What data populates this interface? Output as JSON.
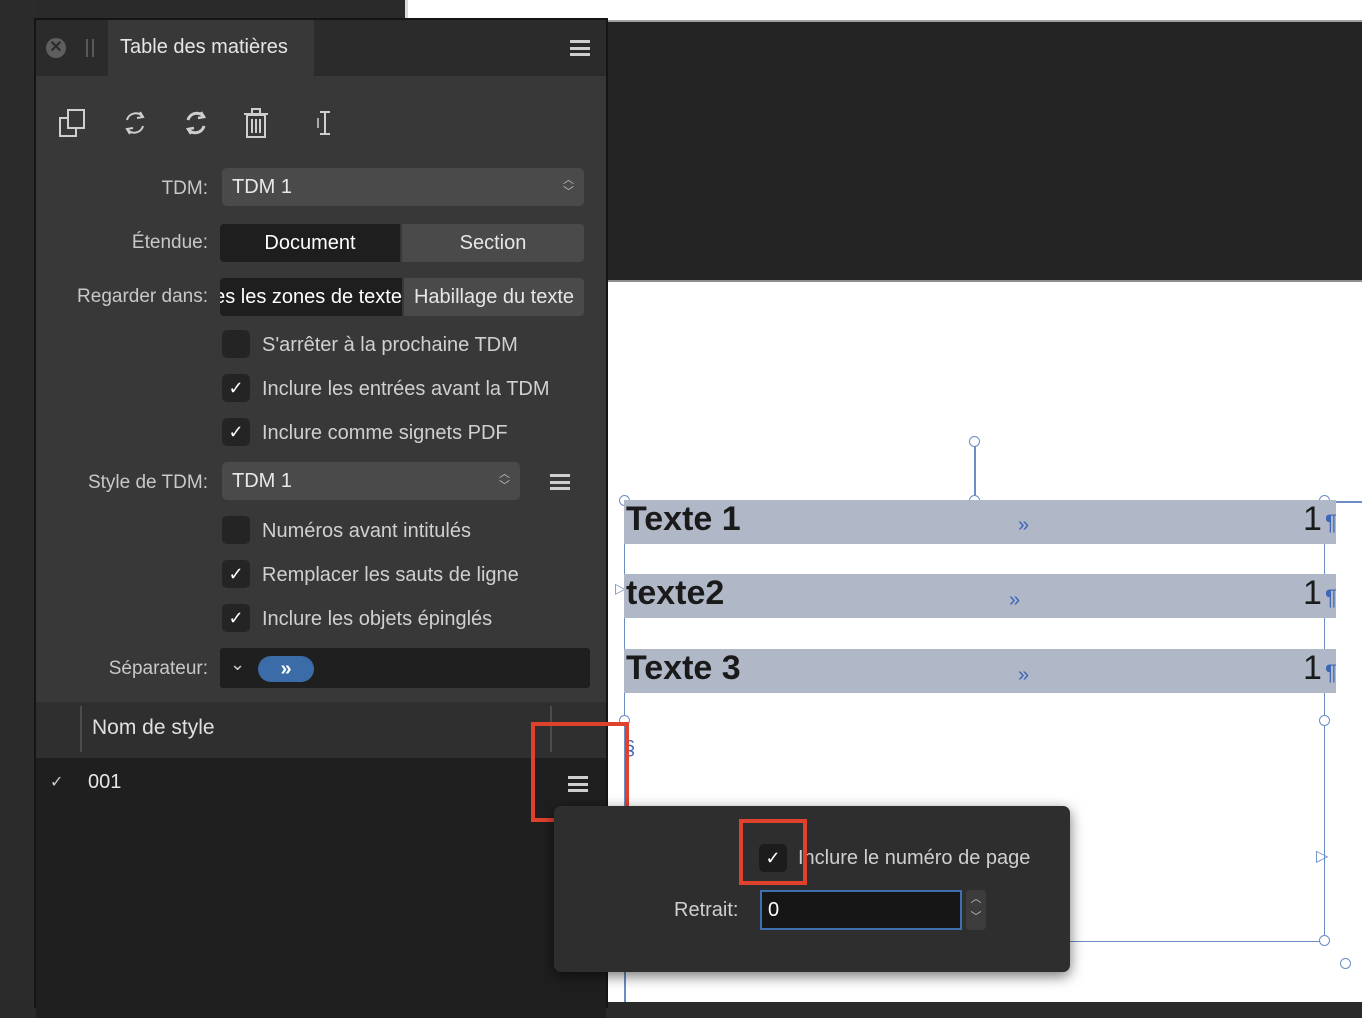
{
  "panel": {
    "title": "Table des matières",
    "close_glyph": "✕",
    "toolbar": {
      "icons": [
        "duplicate-icon",
        "refresh-icon",
        "update-icon",
        "trash-icon",
        "text-cursor-icon"
      ]
    },
    "tdm": {
      "label": "TDM:",
      "value": "TDM 1"
    },
    "etendue": {
      "label": "Étendue:",
      "options": [
        "Document",
        "Section"
      ],
      "selected": "Document"
    },
    "regarder": {
      "label": "Regarder dans:",
      "options": [
        "ıtes les zones de texte",
        "Habillage du texte"
      ],
      "selected": "ıtes les zones de texte"
    },
    "checks_a": [
      {
        "label": "S'arrêter à la prochaine TDM",
        "checked": false
      },
      {
        "label": "Inclure les entrées avant la TDM",
        "checked": true
      },
      {
        "label": "Inclure comme signets PDF",
        "checked": true
      }
    ],
    "style_tdm": {
      "label": "Style de TDM:",
      "value": "TDM 1"
    },
    "checks_b": [
      {
        "label": "Numéros avant intitulés",
        "checked": false
      },
      {
        "label": "Remplacer les sauts de ligne",
        "checked": true
      },
      {
        "label": "Inclure les objets épinglés",
        "checked": true
      }
    ],
    "separateur": {
      "label": "Séparateur:",
      "token": "»"
    },
    "list": {
      "header": "Nom de style",
      "rows": [
        {
          "name": "001",
          "checked": true
        }
      ]
    }
  },
  "document": {
    "entries": [
      {
        "text": "Texte 1",
        "sep": "»",
        "page": "1",
        "pilcrow": "¶"
      },
      {
        "text": "texte2",
        "sep": "»",
        "page": "1",
        "pilcrow": "¶"
      },
      {
        "text": "Texte 3",
        "sep": "»",
        "page": "1",
        "pilcrow": "¶"
      }
    ],
    "section_mark": "§"
  },
  "popover": {
    "include_page_number": {
      "label": "Inclure le numéro de page",
      "checked": true
    },
    "retrait": {
      "label": "Retrait:",
      "value": "0"
    }
  },
  "colors": {
    "accent": "#3b6ca8",
    "highlight_box": "#e0412d",
    "toc_bar": "#b0b8c8",
    "frame": "#6b8cc4"
  }
}
